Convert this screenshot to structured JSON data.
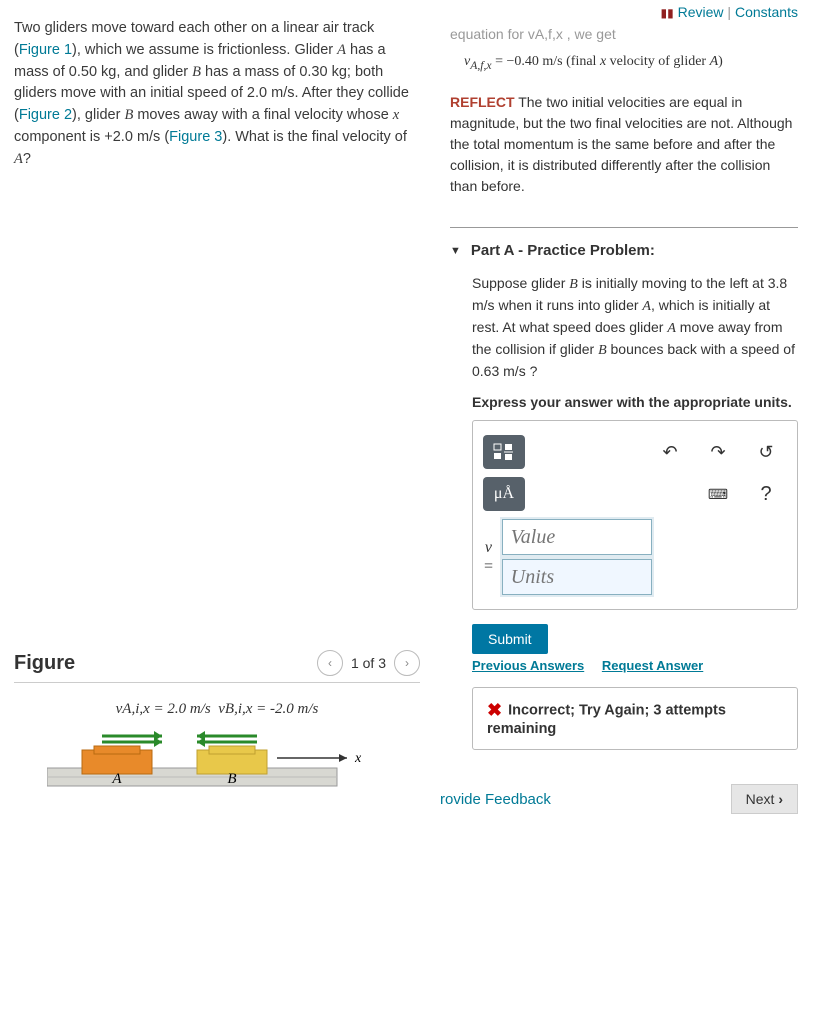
{
  "top": {
    "review": "Review",
    "constants": "Constants"
  },
  "problem": {
    "text_before_fig1": "Two gliders move toward each other on a linear air track (",
    "fig1": "Figure 1",
    "text_after_fig1": "), which we assume is frictionless. Glider ",
    "A": "A",
    "mass_A": " has a mass of 0.50 ",
    "kg": "kg",
    "text_gliderB": ", and glider ",
    "B": "B",
    "mass_B": " has a mass of 0.30 ",
    "text_both": "; both gliders move with an initial speed of 2.0 ",
    "ms": "m/s",
    "text_after_collide": ". After they collide (",
    "fig2": "Figure 2",
    "text_gliderB_moves": "), glider ",
    "text_final_vel": " moves away with a final velocity whose ",
    "x": "x",
    "text_component": " component is +2.0 ",
    "text_paren": " (",
    "fig3": "Figure 3",
    "text_what": "). What is the final velocity of ",
    "text_q": "?"
  },
  "equation": {
    "faded": "equation for vA,f,x , we get",
    "var": "vA,f,x",
    "eq": " = −0.40 m/s",
    "note1": " (final ",
    "xvar": "x",
    "note2": " velocity of glider ",
    "Avar": "A",
    "note3": ")"
  },
  "reflect": {
    "label": "REFLECT",
    "text": " The two initial velocities are equal in magnitude, but the two final velocities are not. Although the total momentum is the same before and after the collision, it is distributed differently after the collision than before."
  },
  "partA": {
    "title": "Part A - Practice Problem:",
    "q1": "Suppose glider ",
    "B": "B",
    "q2": " is initially moving to the left at 3.8 ",
    "ms": "m/s",
    "q3": " when it runs into glider ",
    "A": "A",
    "q4": ", which is initially at rest. At what speed does glider ",
    "q5": " move away from the collision if glider ",
    "q6": " bounces back with a speed of 0.63 ",
    "q7": " ?",
    "instruction": "Express your answer with the appropriate units.",
    "muA": "μÅ",
    "question_mark": "?",
    "value_ph": "Value",
    "units_ph": "Units",
    "v_label": "v",
    "eq_label": "=",
    "submit": "Submit",
    "prev_answers": "Previous Answers",
    "request_answer": "Request Answer"
  },
  "feedback": {
    "text": "Incorrect; Try Again; 3 attempts remaining"
  },
  "figure": {
    "title": "Figure",
    "count": "1 of 3",
    "vA": "vA,i,x = 2.0 m/s",
    "vB": "vB,i,x = -2.0 m/s",
    "A": "A",
    "B": "B",
    "x": "x"
  },
  "bottom": {
    "feedback": "rovide Feedback",
    "next": "Next"
  }
}
